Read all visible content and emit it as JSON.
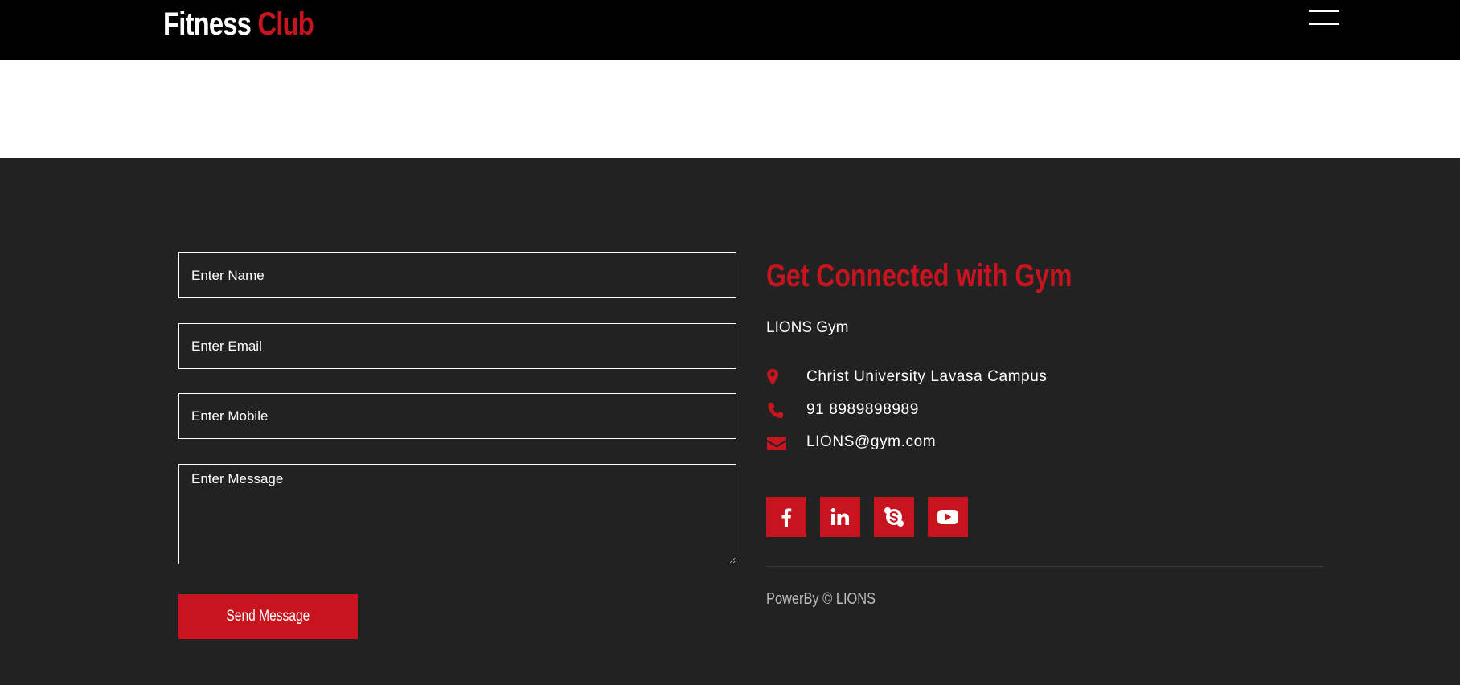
{
  "header": {
    "brand_part1": "Fitness",
    "brand_part2": "Club",
    "menu_icon": "hamburger-menu-icon"
  },
  "form": {
    "name_placeholder": "Enter Name",
    "email_placeholder": "Enter Email",
    "mobile_placeholder": "Enter Mobile",
    "message_placeholder": "Enter Message",
    "submit_label": "Send Message"
  },
  "contact": {
    "title": "Get Connected with Gym",
    "gym_name": "LIONS Gym",
    "address": "Christ University Lavasa Campus",
    "phone": "91 8989898989",
    "email": "LIONS@gym.com"
  },
  "social": [
    "facebook-icon",
    "linkedin-icon",
    "skype-icon",
    "youtube-icon"
  ],
  "footer": {
    "powered_by": "PowerBy © LIONS"
  },
  "colors": {
    "accent": "#c8141e",
    "header_bg": "#000000",
    "footer_bg": "#222222",
    "text": "#ffffff"
  }
}
